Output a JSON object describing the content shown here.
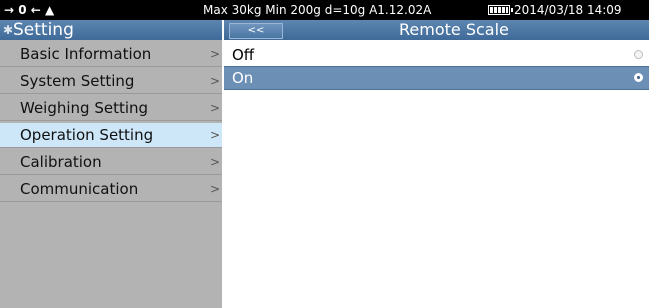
{
  "status": {
    "icons_text": "→ 0 ← ▲",
    "specs": "Max 30kg  Min 200g  d=10g    A1.12.02A",
    "datetime": "2014/03/18  14:09"
  },
  "sidebar": {
    "title": "Setting",
    "items": [
      {
        "label": "Basic Information",
        "active": false
      },
      {
        "label": "System Setting",
        "active": false
      },
      {
        "label": "Weighing Setting",
        "active": false
      },
      {
        "label": "Operation Setting",
        "active": true
      },
      {
        "label": "Calibration",
        "active": false
      },
      {
        "label": "Communication",
        "active": false
      }
    ],
    "chevron": ">"
  },
  "main": {
    "back_label": "<<",
    "title": "Remote Scale",
    "options": [
      {
        "label": "Off",
        "selected": false
      },
      {
        "label": "On",
        "selected": true
      }
    ]
  },
  "colors": {
    "header_blue": "#4f79a6",
    "sidebar_gray": "#b3b3b3",
    "active_item": "#cde7f9",
    "selected_row": "#6c8fb6"
  },
  "icons": {
    "gear": "gear-icon",
    "battery": "battery-icon",
    "radio": "radio-icon",
    "chevron": "chevron-right-icon"
  }
}
